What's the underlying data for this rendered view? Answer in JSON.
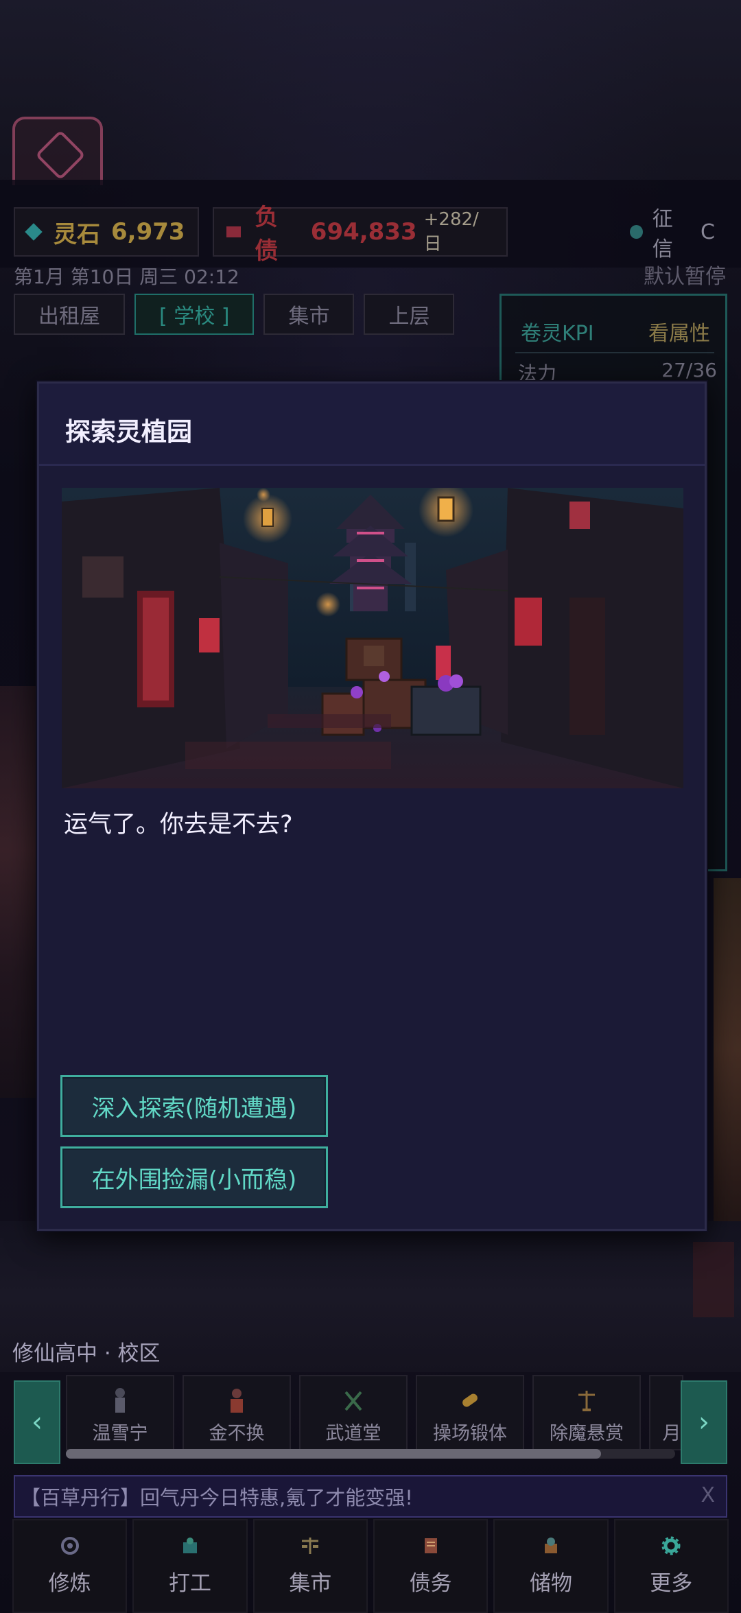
{
  "resources": {
    "spirit_stone": {
      "label": "灵石",
      "value": "6,973",
      "color": "#b8943e"
    },
    "debt": {
      "label": "负债",
      "value": "694,833",
      "delta": "+282/日",
      "color": "#a8323c"
    },
    "credit": {
      "label": "征信",
      "value": "C"
    }
  },
  "date": {
    "text": "第1月 第10日 周三 02:12"
  },
  "pause_label": "默认暂停",
  "tabs": [
    "出租屋",
    "[ 学校 ]",
    "集市",
    "上层"
  ],
  "kpi": {
    "title": "卷灵KPI",
    "link": "看属性",
    "stat_label": "法力",
    "stat_value": "27/36"
  },
  "modal": {
    "title": "探索灵植园",
    "text": "运气了。你去是不去?",
    "choices": [
      "深入探索(随机遭遇)",
      "在外围捡漏(小而稳)"
    ]
  },
  "campus": {
    "location": "修仙高中 · 校区"
  },
  "shortcuts": [
    {
      "label": "温雪宁",
      "icon": "student-girl-icon"
    },
    {
      "label": "金不换",
      "icon": "merchant-icon"
    },
    {
      "label": "武道堂",
      "icon": "crossed-swords-icon"
    },
    {
      "label": "操场锻体",
      "icon": "dumbbell-icon"
    },
    {
      "label": "除魔悬赏",
      "icon": "scales-icon"
    },
    {
      "label": "月",
      "icon": "partial-icon"
    }
  ],
  "carousel": {
    "left_arrow": "‹",
    "right_arrow": "›"
  },
  "banner": {
    "text": "【百草丹行】回气丹今日特惠,氪了才能变强!",
    "close": "X"
  },
  "nav": [
    {
      "label": "修炼",
      "icon": "cultivate-icon"
    },
    {
      "label": "打工",
      "icon": "work-icon"
    },
    {
      "label": "集市",
      "icon": "market-icon"
    },
    {
      "label": "债务",
      "icon": "debt-scroll-icon"
    },
    {
      "label": "储物",
      "icon": "storage-icon"
    },
    {
      "label": "更多",
      "icon": "gear-icon"
    }
  ],
  "colors": {
    "accent": "#3fae9e",
    "modal_bg": "#1b1a36"
  }
}
